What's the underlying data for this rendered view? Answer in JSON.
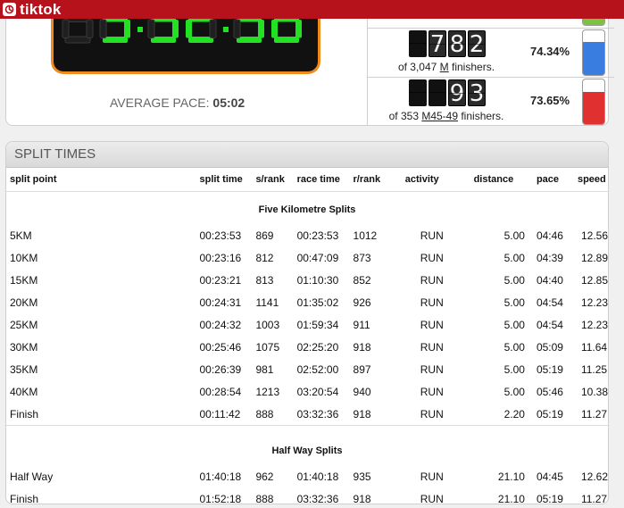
{
  "brand": {
    "name": "tiktok"
  },
  "result": {
    "clock_display": "3:32:36",
    "average_pace_label": "AVERAGE PACE:",
    "average_pace_value": "05:02",
    "ranks": [
      {
        "digits": [
          "",
          "7",
          "8",
          "2"
        ],
        "of_prefix": "of 3,047 ",
        "category": "M",
        "of_suffix": " finishers.",
        "percent": "74.34%",
        "fill": 0.74,
        "color": "#3a7de0"
      },
      {
        "digits": [
          "",
          "",
          "9",
          "3"
        ],
        "of_prefix": "of 353 ",
        "category": "M45-49",
        "of_suffix": " finishers.",
        "percent": "73.65%",
        "fill": 0.73,
        "color": "#e03030"
      }
    ],
    "top_gauge_color": "#7cc142"
  },
  "splits": {
    "title": "SPLIT TIMES",
    "columns": [
      "split point",
      "split time",
      "s/rank",
      "race time",
      "r/rank",
      "activity",
      "distance",
      "pace",
      "speed"
    ],
    "five_km_title": "Five Kilometre Splits",
    "five_km_rows": [
      [
        "5KM",
        "00:23:53",
        "869",
        "00:23:53",
        "1012",
        "RUN",
        "5.00",
        "04:46",
        "12.56"
      ],
      [
        "10KM",
        "00:23:16",
        "812",
        "00:47:09",
        "873",
        "RUN",
        "5.00",
        "04:39",
        "12.89"
      ],
      [
        "15KM",
        "00:23:21",
        "813",
        "01:10:30",
        "852",
        "RUN",
        "5.00",
        "04:40",
        "12.85"
      ],
      [
        "20KM",
        "00:24:31",
        "1141",
        "01:35:02",
        "926",
        "RUN",
        "5.00",
        "04:54",
        "12.23"
      ],
      [
        "25KM",
        "00:24:32",
        "1003",
        "01:59:34",
        "911",
        "RUN",
        "5.00",
        "04:54",
        "12.23"
      ],
      [
        "30KM",
        "00:25:46",
        "1075",
        "02:25:20",
        "918",
        "RUN",
        "5.00",
        "05:09",
        "11.64"
      ],
      [
        "35KM",
        "00:26:39",
        "981",
        "02:52:00",
        "897",
        "RUN",
        "5.00",
        "05:19",
        "11.25"
      ],
      [
        "40KM",
        "00:28:54",
        "1213",
        "03:20:54",
        "940",
        "RUN",
        "5.00",
        "05:46",
        "10.38"
      ],
      [
        "Finish",
        "00:11:42",
        "888",
        "03:32:36",
        "918",
        "RUN",
        "2.20",
        "05:19",
        "11.27"
      ]
    ],
    "half_title": "Half Way Splits",
    "half_rows": [
      [
        "Half Way",
        "01:40:18",
        "962",
        "01:40:18",
        "935",
        "RUN",
        "21.10",
        "04:45",
        "12.62"
      ],
      [
        "Finish",
        "01:52:18",
        "888",
        "03:32:36",
        "918",
        "RUN",
        "21.10",
        "05:19",
        "11.27"
      ]
    ]
  }
}
